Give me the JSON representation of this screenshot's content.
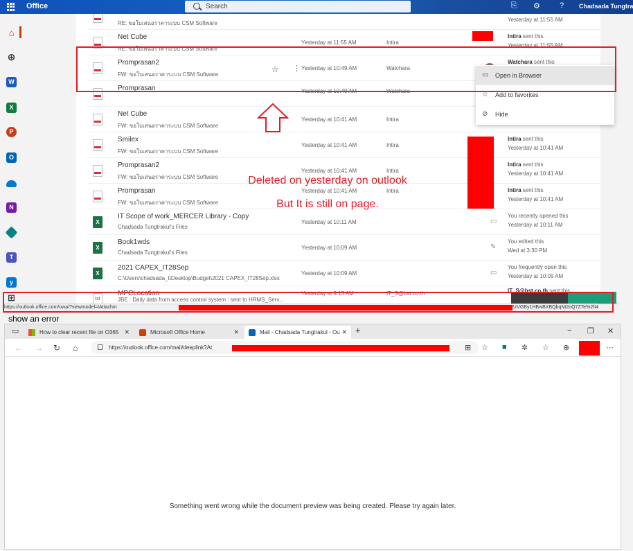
{
  "office": {
    "brand": "Office",
    "search_placeholder": "Search",
    "user_name": "Chadsada Tungtrakul"
  },
  "files": [
    {
      "name": "Net Cube",
      "location": "RE: ขอใบเสนอราคาระบบ CSM Software",
      "date": "Yesterday at 11:55 AM",
      "owner": "Intira",
      "activity_who": "Intira",
      "activity_verb": "sent this",
      "activity_when": "Yesterday at 11:55 AM",
      "icon": "pdf"
    },
    {
      "name": "Promprasan2",
      "location": "FW: ขอใบเสนอราคาระบบ CSM Software",
      "date": "Yesterday at 10:49 AM",
      "owner": "Watchara",
      "activity_who": "Watchara",
      "activity_verb": "sent this",
      "activity_when": "",
      "icon": "pdf"
    },
    {
      "name": "Promprasan",
      "location": "FW: ขอใบเสนอราคาระบบ CSM Software",
      "date": "Yesterday at 10:49 AM",
      "owner": "Watchara",
      "activity_who": "",
      "activity_verb": "",
      "activity_when": "",
      "icon": "pdf"
    },
    {
      "name": "Net Cube",
      "location": "FW: ขอใบเสนอราคาระบบ CSM Software",
      "date": "Yesterday at 10:41 AM",
      "owner": "Intira",
      "activity_who": "",
      "activity_verb": "",
      "activity_when": "",
      "icon": "pdf"
    },
    {
      "name": "Smilex",
      "location": "FW: ขอใบเสนอราคาระบบ CSM Software",
      "date": "Yesterday at 10:41 AM",
      "owner": "Intira",
      "activity_who": "Intira",
      "activity_verb": "sent this",
      "activity_when": "Yesterday at 10:41 AM",
      "icon": "pdf"
    },
    {
      "name": "Promprasan2",
      "location": "FW: ขอใบเสนอราคาระบบ CSM Software",
      "date": "Yesterday at 10:41 AM",
      "owner": "Intira",
      "activity_who": "Intira",
      "activity_verb": "sent this",
      "activity_when": "Yesterday at 10:41 AM",
      "icon": "pdf"
    },
    {
      "name": "Promprasan",
      "location": "FW: ขอใบเสนอราคาระบบ CSM Software",
      "date": "Yesterday at 10:41 AM",
      "owner": "Intira",
      "activity_who": "Intira",
      "activity_verb": "sent this",
      "activity_when": "Yesterday at 10:41 AM",
      "icon": "pdf"
    },
    {
      "name": "IT Scope of work_MERCER Library - Copy",
      "location": "Chadsada Tungtrakul's Files",
      "date": "Yesterday at 10:11 AM",
      "owner": "",
      "activity_who": "",
      "activity_verb": "You recently opened this",
      "activity_when": "Yesterday at 10:11 AM",
      "icon": "xls"
    },
    {
      "name": "Book1wds",
      "location": "Chadsada Tungtrakul's Files",
      "date": "Yesterday at 10:09 AM",
      "owner": "",
      "activity_who": "",
      "activity_verb": "You edited this",
      "activity_when": "Wed at 3:30 PM",
      "icon": "xls"
    },
    {
      "name": "2021 CAPEX_IT28Sep",
      "location": "C:\\Users\\chadsada_t\\Desktop\\Budget\\2021 CAPEX_IT28Sep.xlsx",
      "date": "Yesterday at 10:09 AM",
      "owner": "",
      "activity_who": "",
      "activity_verb": "You frequently open this",
      "activity_when": "Yesterday at 10:09 AM",
      "icon": "xls"
    },
    {
      "name": "MPCLocation",
      "location": "JBE : Daily data from access control system : sent to HRMS_Serv...",
      "date": "Yesterday at 8:13 AM",
      "owner": "IT_S@bst.co.th",
      "activity_who": "IT_S@bst.co.th",
      "activity_verb": "sent this",
      "activity_when": "",
      "icon": "txt"
    }
  ],
  "context_menu": {
    "open_browser": "Open in Browser",
    "add_favorites": "Add to favorites",
    "hide": "Hide"
  },
  "annotation": {
    "line1": "Deleted on yesterday on outlook",
    "line2": "But It is still on page."
  },
  "status_url": "https://outlook.office.com/owa/?viewmodel=IAttachm",
  "status_url_end": "EzVGBy1HBwBXBQbqNt2oQ7ZTe%2fI4",
  "caption": "show an error",
  "browser": {
    "tabs": [
      {
        "title": "How to clear recent file on O365",
        "active": false
      },
      {
        "title": "Microsoft Office Home",
        "active": false
      },
      {
        "title": "Mail - Chadsada Tungtrakul - Ou",
        "active": true
      }
    ],
    "url": "https://outlook.office.com/mail/deeplink?At",
    "error": "Something went wrong while the document preview was being created. Please try again later."
  },
  "colors": {
    "accent": "#e31b23",
    "office_blue": "#1565c0"
  }
}
